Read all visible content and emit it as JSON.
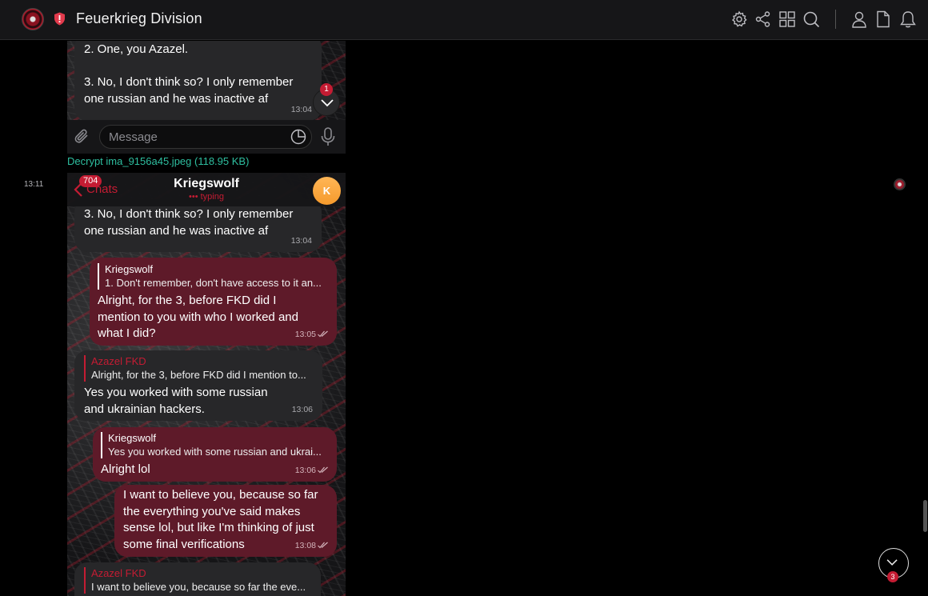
{
  "header": {
    "title": "Feuerkrieg Division",
    "icons": [
      "settings-icon",
      "share-icon",
      "grid-icon",
      "search-icon",
      "user-icon",
      "file-icon",
      "bell-icon"
    ]
  },
  "embed_top": {
    "msg_a": {
      "text": "2. One, you Azazel.\n\n3. No, I don't think so? I only remember one russian and he was inactive af",
      "time": "13:04"
    },
    "scroll_badge": "1",
    "composer_placeholder": "Message"
  },
  "attachment": {
    "label": "Decrypt ima_9156a45.jpeg (118.95 KB)"
  },
  "post": {
    "time": "13:11"
  },
  "chat": {
    "back_label": "Chats",
    "unread_count": "704",
    "title": "Kriegswolf",
    "status": "••• typing",
    "avatar_letter": "K",
    "messages": [
      {
        "text": "3. No, I don't think so? I only remember one russian and he was inactive af",
        "time": "13:04"
      },
      {
        "reply_name": "Kriegswolf",
        "reply_text": "1. Don't remember, don't have access to it an...",
        "text": "Alright, for the 3, before FKD did I mention to you with who I worked and what I did?",
        "time": "13:05"
      },
      {
        "reply_name": "Azazel FKD",
        "reply_text": "Alright, for the 3, before FKD did I mention to...",
        "text": "Yes you worked with some russian and ukrainian hackers.",
        "time": "13:06"
      },
      {
        "reply_name": "Kriegswolf",
        "reply_text": "Yes you worked with some russian and ukrai...",
        "text": "Alright lol",
        "time": "13:06"
      },
      {
        "text": "I want to believe you, because so far the everything you've said makes sense lol, but like I'm thinking of just some final verifications",
        "time": "13:08"
      },
      {
        "reply_name": "Azazel FKD",
        "reply_text": "I want to believe you, because so far the eve..."
      }
    ]
  },
  "page": {
    "scroll_badge": "3"
  },
  "colors": {
    "accent": "#c41c33",
    "outgoing": "#5e1a29",
    "incoming": "#272729",
    "link": "#2ebfa0"
  }
}
